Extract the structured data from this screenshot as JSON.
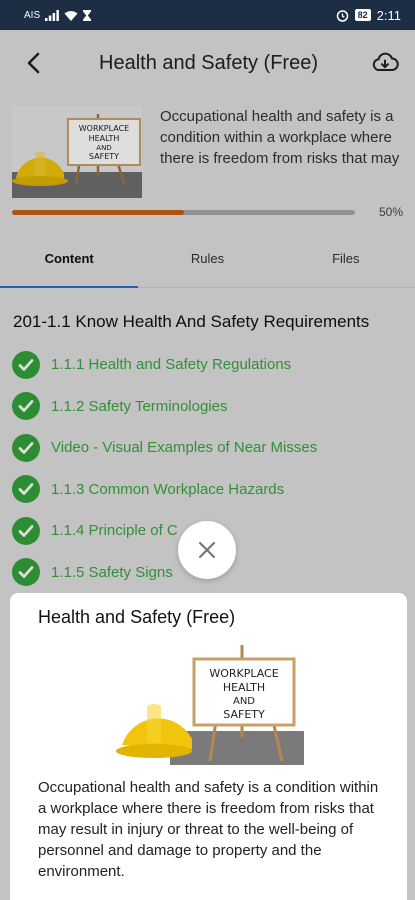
{
  "status_bar": {
    "carrier": "AIS",
    "battery": "82",
    "time": "2:11"
  },
  "header": {
    "title": "Health and Safety (Free)",
    "back_icon": "chevron-left-icon",
    "download_icon": "cloud-download-icon"
  },
  "course": {
    "intro": "Occupational health and safety is a condition within a workplace where there is freedom from risks that may",
    "image_sign_text": [
      "WORKPLACE",
      "HEALTH",
      "AND",
      "SAFETY"
    ],
    "progress": 0.5,
    "progress_label": "50%"
  },
  "tabs": [
    {
      "label": "Content",
      "active": true
    },
    {
      "label": "Rules",
      "active": false
    },
    {
      "label": "Files",
      "active": false
    }
  ],
  "section": {
    "title": "201-1.1 Know Health And Safety Requirements",
    "lessons": [
      {
        "label": "1.1.1 Health and Safety Regulations",
        "completed": true
      },
      {
        "label": "1.1.2 Safety Terminologies",
        "completed": true
      },
      {
        "label": "Video - Visual Examples of Near Misses",
        "completed": true
      },
      {
        "label": "1.1.3 Common Workplace Hazards",
        "completed": true
      },
      {
        "label": "1.1.4 Principle of C",
        "completed": true
      },
      {
        "label": "1.1.5 Safety Signs",
        "completed": true
      }
    ]
  },
  "popup": {
    "title": "Health and Safety (Free)",
    "description": "Occupational health and safety is a condition within a workplace where there is freedom from risks that may result in injury or threat to the well-being of personnel and damage to property and the environment.",
    "close_icon": "close-icon"
  },
  "colors": {
    "status_bar": "#1c2d44",
    "progress": "#c85f12",
    "check": "#34a23a",
    "tab_underline": "#2e6fd0"
  }
}
